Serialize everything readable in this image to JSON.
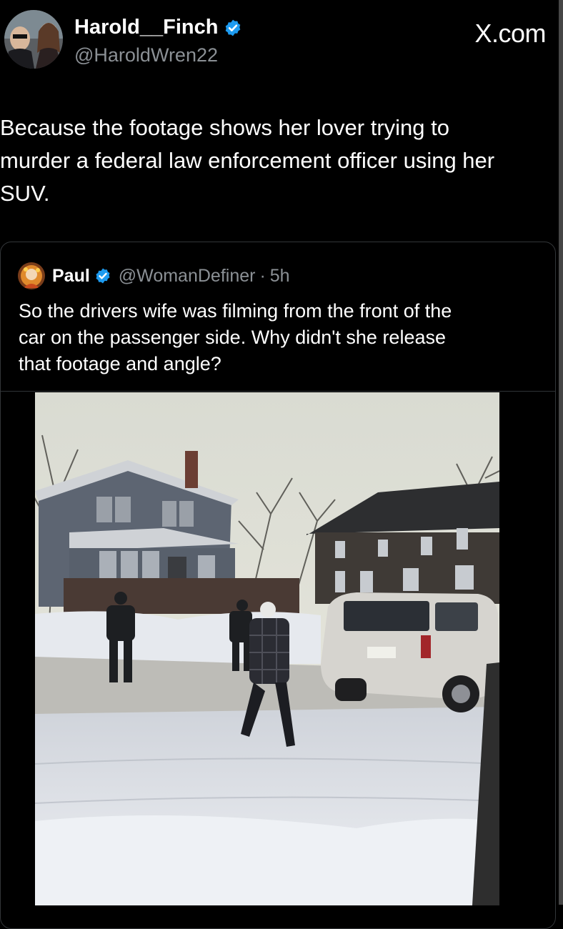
{
  "author": {
    "name": "Harold__Finch",
    "handle": "@HaroldWren22",
    "verified": true,
    "avatar_icon": "profile-photo-icon"
  },
  "watermark": "X.com",
  "tweet": {
    "text": "Because the footage shows her lover trying to\nmurder a federal law enforcement officer using her\nSUV."
  },
  "quote": {
    "name": "Paul",
    "handle": "@WomanDefiner",
    "separator": "·",
    "time": "5h",
    "verified": true,
    "text": "So the drivers wife was filming from the front of the\ncar on the passenger side. Why didn't she release\nthat footage and angle?"
  },
  "colors": {
    "background": "#000000",
    "text": "#ffffff",
    "secondary": "#8b9095",
    "verified_blue": "#1d9bf0",
    "border": "#333639"
  }
}
